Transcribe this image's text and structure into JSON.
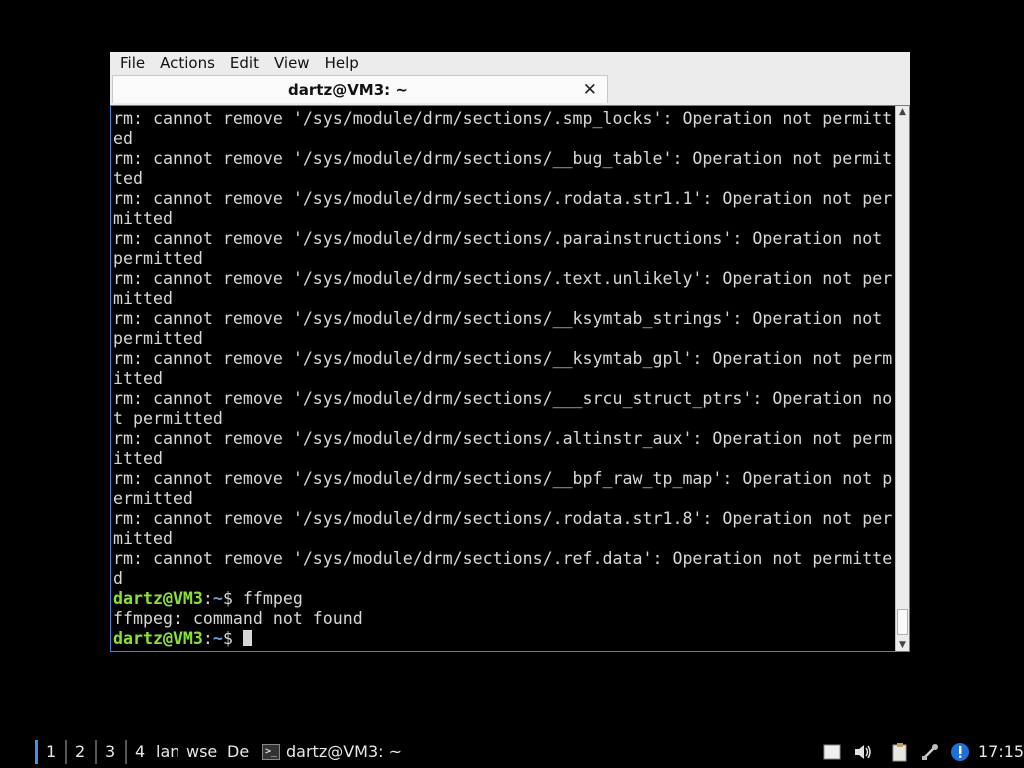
{
  "menubar": {
    "items": [
      "File",
      "Actions",
      "Edit",
      "View",
      "Help"
    ]
  },
  "tab": {
    "title": "dartz@VM3: ~",
    "close": "✕"
  },
  "terminal": {
    "lines": [
      "rm: cannot remove '/sys/module/drm/sections/.smp_locks': Operation not permitt",
      "ed",
      "rm: cannot remove '/sys/module/drm/sections/__bug_table': Operation not permit",
      "ted",
      "rm: cannot remove '/sys/module/drm/sections/.rodata.str1.1': Operation not per",
      "mitted",
      "rm: cannot remove '/sys/module/drm/sections/.parainstructions': Operation not",
      "permitted",
      "rm: cannot remove '/sys/module/drm/sections/.text.unlikely': Operation not per",
      "mitted",
      "rm: cannot remove '/sys/module/drm/sections/__ksymtab_strings': Operation not",
      "permitted",
      "rm: cannot remove '/sys/module/drm/sections/__ksymtab_gpl': Operation not perm",
      "itted",
      "rm: cannot remove '/sys/module/drm/sections/___srcu_struct_ptrs': Operation no",
      "t permitted",
      "rm: cannot remove '/sys/module/drm/sections/.altinstr_aux': Operation not perm",
      "itted",
      "rm: cannot remove '/sys/module/drm/sections/__bpf_raw_tp_map': Operation not p",
      "ermitted",
      "rm: cannot remove '/sys/module/drm/sections/.rodata.str1.8': Operation not per",
      "mitted",
      "rm: cannot remove '/sys/module/drm/sections/.ref.data': Operation not permitte",
      "d"
    ],
    "prompt1": {
      "user": "dartz@VM3",
      "sep": ":",
      "path": "~",
      "symbol": "$ ",
      "command": "ffmpeg"
    },
    "output": "ffmpeg: command not found",
    "prompt2": {
      "user": "dartz@VM3",
      "sep": ":",
      "path": "~",
      "symbol": "$ "
    }
  },
  "taskbar": {
    "workspaces": [
      "1",
      "2",
      "3",
      "4"
    ],
    "labels": [
      "lana",
      "wse",
      "De"
    ],
    "task_label": "dartz@VM3: ~",
    "clock": "17:15",
    "tray_icons": [
      "notes-icon",
      "volume-icon",
      "clipboard-icon",
      "network-icon",
      "info-icon"
    ]
  },
  "colors": {
    "prompt_user": "#8ae234",
    "prompt_path": "#729fcf",
    "terminal_bg": "#000000",
    "terminal_fg": "#d7d7d7",
    "focus_border": "#3e86d8"
  }
}
